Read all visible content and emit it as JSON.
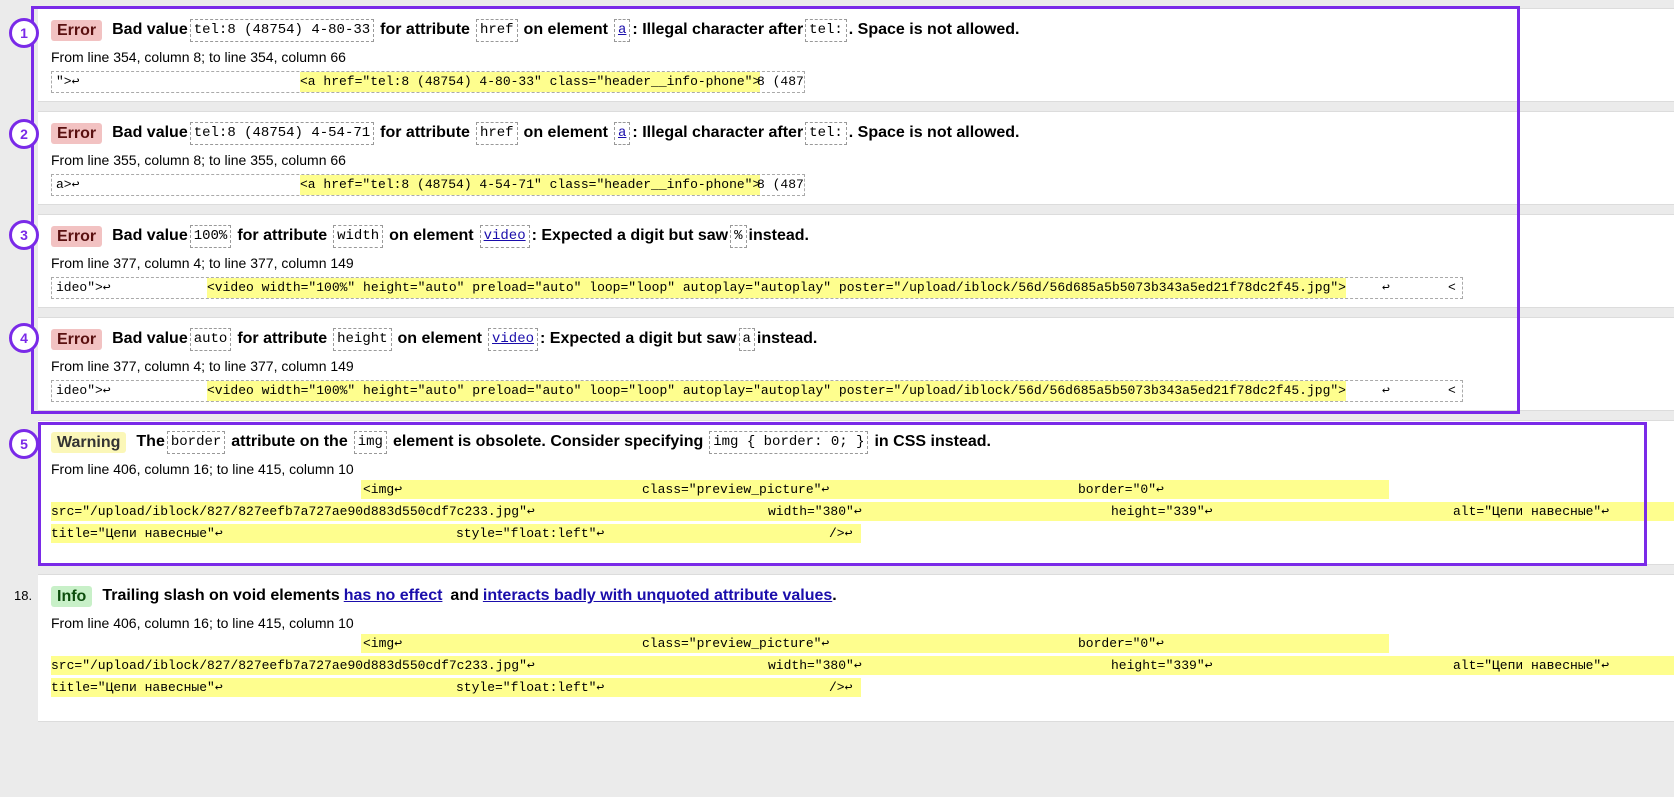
{
  "messages": [
    {
      "marker": "1",
      "type": "Error",
      "parts": [
        "Bad value",
        "tel:8 (48754) 4-80-33",
        "for attribute",
        "href",
        "on element",
        "a",
        ": Illegal character after",
        "tel:",
        ". Space is not allowed."
      ],
      "location": "From line 354, column 8; to line 354, column 66",
      "extract_pre": "\">↩",
      "extract_hl": "<a href=\"tel:8 (48754) 4-80-33\" class=\"header__info-phone\">",
      "extract_post": "8 (487"
    },
    {
      "marker": "2",
      "type": "Error",
      "parts": [
        "Bad value",
        "tel:8 (48754) 4-54-71",
        "for attribute",
        "href",
        "on element",
        "a",
        ": Illegal character after",
        "tel:",
        ". Space is not allowed."
      ],
      "location": "From line 355, column 8; to line 355, column 66",
      "extract_pre": "a>↩",
      "extract_hl": "<a href=\"tel:8 (48754) 4-54-71\" class=\"header__info-phone\">",
      "extract_post": "8 (487"
    },
    {
      "marker": "3",
      "type": "Error",
      "parts": [
        "Bad value",
        "100%",
        "for attribute",
        "width",
        "on element",
        "video",
        ": Expected a digit but saw",
        "%",
        "instead."
      ],
      "location": "From line 377, column 4; to line 377, column 149",
      "extract_pre": "ideo\">↩",
      "extract_hl": "<video width=\"100%\" height=\"auto\" preload=\"auto\" loop=\"loop\" autoplay=\"autoplay\" poster=\"/upload/iblock/56d/56d685a5b5073b343a5ed21f78dc2f45.jpg\">",
      "extract_post": "↩",
      "extract_tail": "<"
    },
    {
      "marker": "4",
      "type": "Error",
      "parts": [
        "Bad value",
        "auto",
        "for attribute",
        "height",
        "on element",
        "video",
        ": Expected a digit but saw",
        "a",
        "instead."
      ],
      "location": "From line 377, column 4; to line 377, column 149",
      "extract_pre": "ideo\">↩",
      "extract_hl": "<video width=\"100%\" height=\"auto\" preload=\"auto\" loop=\"loop\" autoplay=\"autoplay\" poster=\"/upload/iblock/56d/56d685a5b5073b343a5ed21f78dc2f45.jpg\">",
      "extract_post": "↩",
      "extract_tail": "<"
    }
  ],
  "warning": {
    "marker": "5",
    "type": "Warning",
    "parts": [
      "The",
      "border",
      "attribute on the",
      "img",
      "element is obsolete. Consider specifying",
      "img { border: 0; }",
      "in CSS instead."
    ],
    "location": "From line 406, column 16; to line 415, column 10",
    "lines": [
      [
        "<img↩",
        "class=\"preview_picture\"↩",
        "border=\"0\"↩"
      ],
      [
        "src=\"/upload/iblock/827/827eefb7a727ae90d883d550cdf7c233.jpg\"↩",
        "width=\"380\"↩",
        "height=\"339\"↩",
        "alt=\"Цепи навесные\"↩"
      ],
      [
        "title=\"Цепи навесные\"↩",
        "style=\"float:left\"↩",
        "/>↩"
      ]
    ]
  },
  "info": {
    "number": "18.",
    "type": "Info",
    "text_before": "Trailing slash on void elements",
    "link1": "has no effect",
    "text_mid": "and",
    "link2": "interacts badly with unquoted attribute values",
    "text_end": ".",
    "location": "From line 406, column 16; to line 415, column 10",
    "lines": [
      [
        "<img↩",
        "class=\"preview_picture\"↩",
        "border=\"0\"↩"
      ],
      [
        "src=\"/upload/iblock/827/827eefb7a727ae90d883d550cdf7c233.jpg\"↩",
        "width=\"380\"↩",
        "height=\"339\"↩",
        "alt=\"Цепи навесные\"↩"
      ],
      [
        "title=\"Цепи навесные\"↩",
        "style=\"float:left\"↩",
        "/>↩"
      ]
    ]
  },
  "colors": {
    "annotation": "#7a2ae8",
    "highlight": "#fefe8e",
    "error_badge": "#f2c2c2",
    "warning_badge": "#fbf7b8",
    "info_badge": "#c8f0c8",
    "link": "#1a0dab"
  }
}
